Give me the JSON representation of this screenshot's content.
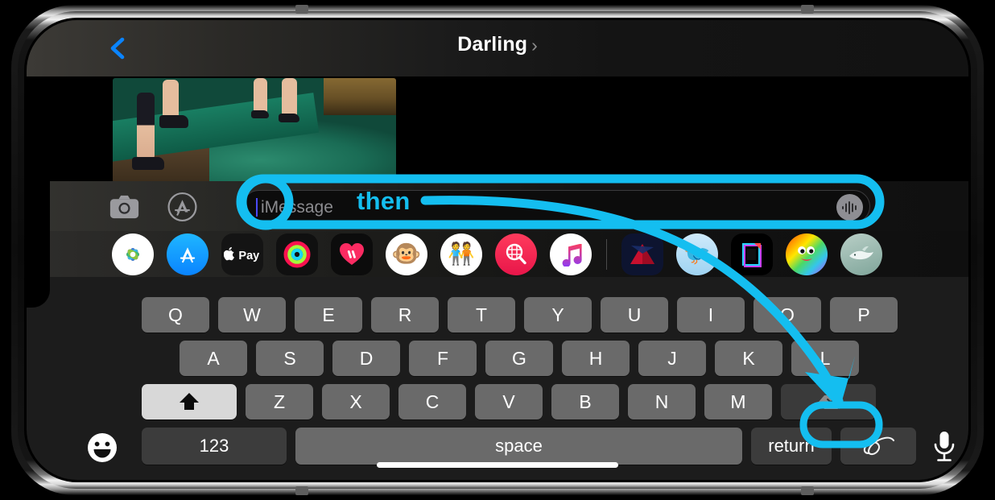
{
  "device": {
    "name": "iPhone",
    "orientation": "landscape"
  },
  "navbar": {
    "back_icon": "chevron-left-icon",
    "title": "Darling",
    "title_chevron": "›"
  },
  "conversation": {
    "attachment_type": "photo-video-thumbnail",
    "attachment_description": "green gym mat with legs"
  },
  "input_bar": {
    "camera_icon": "camera-icon",
    "appstore_icon": "app-store-icon",
    "placeholder": "iMessage",
    "value": "",
    "audio_icon": "audio-waveform-icon"
  },
  "app_drawer": {
    "apps": [
      {
        "name": "Photos",
        "icon": "photos-icon"
      },
      {
        "name": "App Store",
        "icon": "app-store-icon"
      },
      {
        "name": "Apple Pay",
        "icon": "apple-pay-icon"
      },
      {
        "name": "Activity",
        "icon": "activity-rings-icon"
      },
      {
        "name": "Health",
        "icon": "heart-icon"
      },
      {
        "name": "Monkey Emoji",
        "icon": "monkey-emoji-icon"
      },
      {
        "name": "Memoji",
        "icon": "memoji-icon"
      },
      {
        "name": "#images",
        "icon": "image-search-icon"
      },
      {
        "name": "Music",
        "icon": "music-note-icon"
      },
      {
        "name": "Delta",
        "icon": "delta-airlines-icon"
      },
      {
        "name": "Bird App",
        "icon": "bird-character-icon"
      },
      {
        "name": "Document App",
        "icon": "document-color-icon"
      },
      {
        "name": "Rainbow Face",
        "icon": "rainbow-face-icon"
      },
      {
        "name": "Whale",
        "icon": "whale-icon"
      }
    ]
  },
  "keyboard": {
    "row1": [
      "Q",
      "W",
      "E",
      "R",
      "T",
      "Y",
      "U",
      "I",
      "O",
      "P"
    ],
    "row2": [
      "A",
      "S",
      "D",
      "F",
      "G",
      "H",
      "J",
      "K",
      "L"
    ],
    "row3_shift": "shift-icon",
    "row3": [
      "Z",
      "X",
      "C",
      "V",
      "B",
      "N",
      "M"
    ],
    "row3_delete": "delete-icon",
    "emoji_key": "emoji-smiley-icon",
    "numbers_key": "123",
    "space_key": "space",
    "return_key": "return",
    "scribble_key": "handwriting-scribble-icon",
    "dictation_key": "microphone-icon",
    "shift_active": true
  },
  "annotation": {
    "label": "then",
    "color": "#14BEF0",
    "highlight_targets": [
      "message-input-field",
      "scribble-key"
    ],
    "arrow_description": "curved arrow from message field to handwriting key"
  },
  "home_indicator": "home-indicator-bar"
}
